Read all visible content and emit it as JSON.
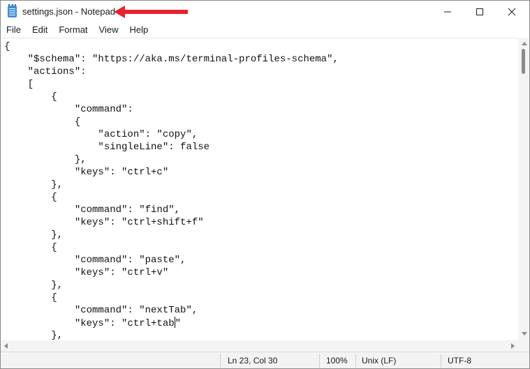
{
  "window": {
    "title": "settings.json - Notepad",
    "app_icon": "notepad-icon",
    "annotation_arrow_color": "#e8212a",
    "controls": {
      "minimize_icon": "minimize-icon",
      "maximize_icon": "maximize-icon",
      "close_icon": "close-icon"
    }
  },
  "menu": {
    "items": [
      "File",
      "Edit",
      "Format",
      "View",
      "Help"
    ]
  },
  "editor": {
    "lines": [
      "{",
      "    \"$schema\": \"https://aka.ms/terminal-profiles-schema\",",
      "    \"actions\":",
      "    [",
      "        {",
      "            \"command\":",
      "            {",
      "                \"action\": \"copy\",",
      "                \"singleLine\": false",
      "            },",
      "            \"keys\": \"ctrl+c\"",
      "        },",
      "        {",
      "            \"command\": \"find\",",
      "            \"keys\": \"ctrl+shift+f\"",
      "        },",
      "        {",
      "            \"command\": \"paste\",",
      "            \"keys\": \"ctrl+v\"",
      "        },",
      "        {",
      "            \"command\": \"nextTab\",",
      "            \"keys\": \"ctrl+tab\"",
      "        },"
    ],
    "caret_line": 23,
    "caret_col": 30
  },
  "statusbar": {
    "position": "Ln 23, Col 30",
    "zoom": "100%",
    "line_ending": "Unix (LF)",
    "encoding": "UTF-8"
  }
}
